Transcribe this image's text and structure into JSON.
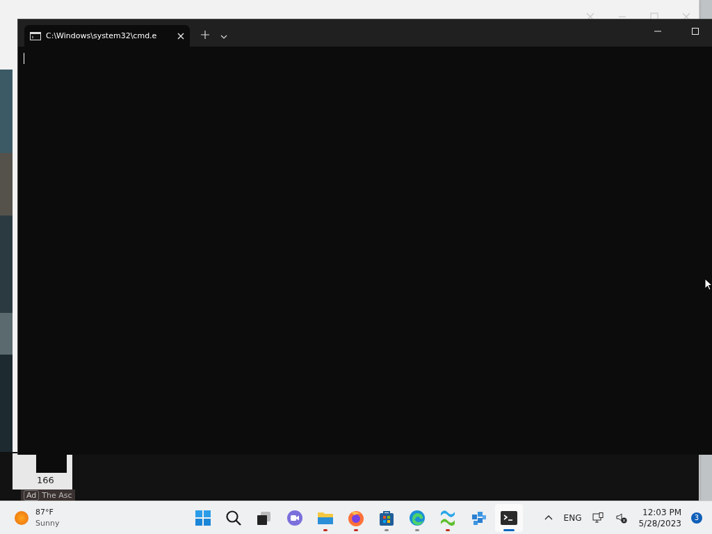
{
  "background_window": {
    "card_text": "166",
    "ad_badge": "Ad",
    "ad_text": "The Asc"
  },
  "terminal": {
    "tabs": [
      {
        "title": "C:\\Windows\\system32\\cmd.e",
        "selected": true
      }
    ],
    "cursor": true
  },
  "taskbar": {
    "weather": {
      "temperature": "87°F",
      "condition": "Sunny"
    },
    "apps": [
      {
        "kind": "start",
        "running": false,
        "active": false
      },
      {
        "kind": "search",
        "running": false,
        "active": false
      },
      {
        "kind": "taskview",
        "running": false,
        "active": false
      },
      {
        "kind": "chat",
        "running": false,
        "active": false
      },
      {
        "kind": "explorer",
        "running": true,
        "active": false,
        "color": "#c42b1c"
      },
      {
        "kind": "firefox",
        "running": true,
        "active": false,
        "color": "#c42b1c"
      },
      {
        "kind": "store",
        "running": true,
        "active": false,
        "color": "#8a8a8a"
      },
      {
        "kind": "edge",
        "running": true,
        "active": false,
        "color": "#8a8a8a"
      },
      {
        "kind": "wave",
        "running": true,
        "active": false,
        "color": "#c42b1c"
      },
      {
        "kind": "cubes",
        "running": false,
        "active": false
      },
      {
        "kind": "terminal",
        "running": true,
        "active": true,
        "color": "#0067c0"
      }
    ],
    "language": "ENG",
    "time": "12:03 PM",
    "date": "5/28/2023",
    "notification_count": "3"
  }
}
